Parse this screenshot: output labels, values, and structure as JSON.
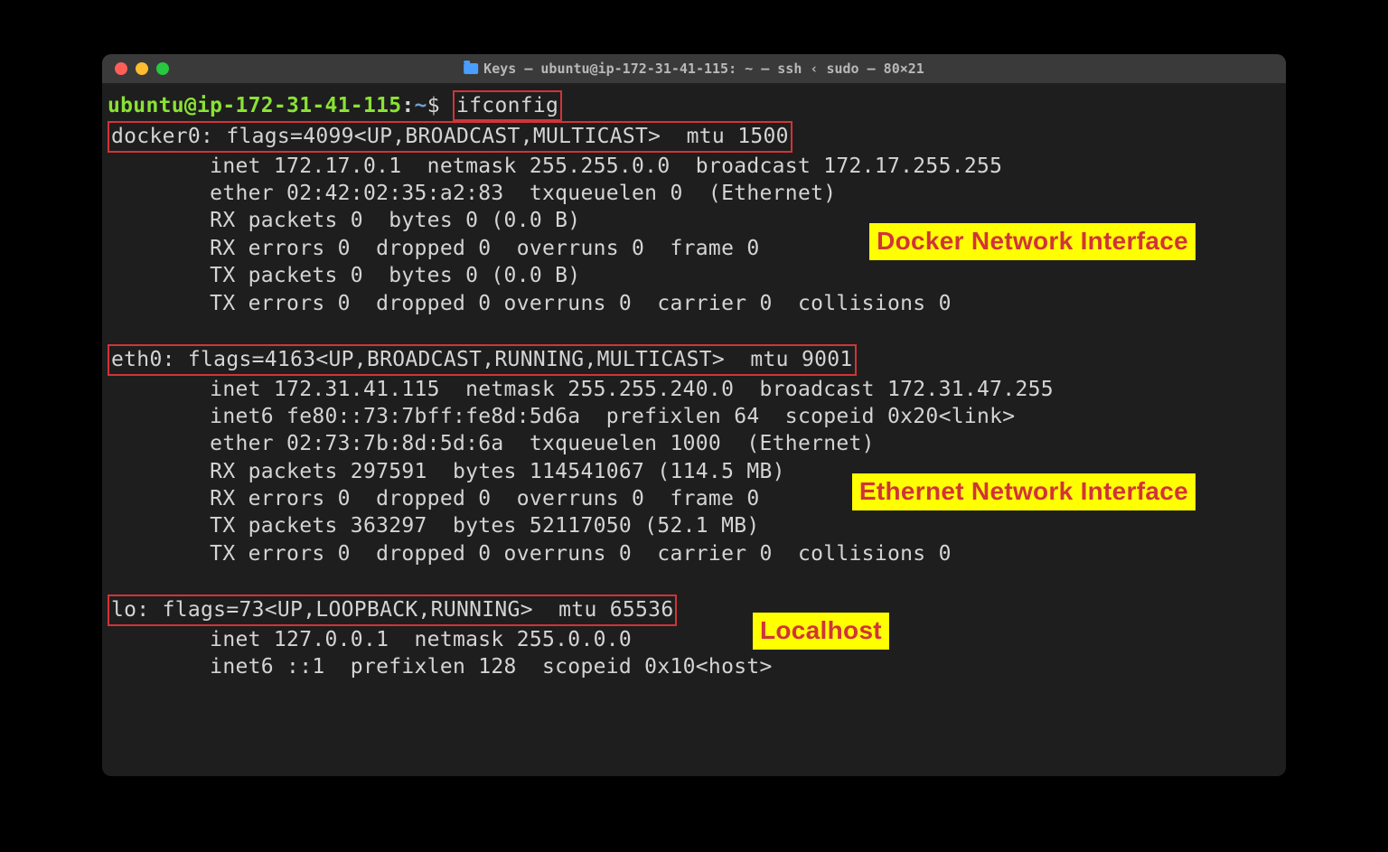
{
  "window": {
    "title": "Keys — ubuntu@ip-172-31-41-115: ~ — ssh ‹ sudo — 80×21"
  },
  "prompt": {
    "user": "ubuntu@ip-172-31-41-115",
    "path": "~",
    "command": "ifconfig"
  },
  "interfaces": {
    "docker0": {
      "header": "docker0: flags=4099<UP,BROADCAST,MULTICAST>  mtu 1500",
      "line1": "        inet 172.17.0.1  netmask 255.255.0.0  broadcast 172.17.255.255",
      "line2": "        ether 02:42:02:35:a2:83  txqueuelen 0  (Ethernet)",
      "line3": "        RX packets 0  bytes 0 (0.0 B)",
      "line4": "        RX errors 0  dropped 0  overruns 0  frame 0",
      "line5": "        TX packets 0  bytes 0 (0.0 B)",
      "line6": "        TX errors 0  dropped 0 overruns 0  carrier 0  collisions 0"
    },
    "eth0": {
      "header": "eth0: flags=4163<UP,BROADCAST,RUNNING,MULTICAST>  mtu 9001",
      "line1": "        inet 172.31.41.115  netmask 255.255.240.0  broadcast 172.31.47.255",
      "line2": "        inet6 fe80::73:7bff:fe8d:5d6a  prefixlen 64  scopeid 0x20<link>",
      "line3": "        ether 02:73:7b:8d:5d:6a  txqueuelen 1000  (Ethernet)",
      "line4": "        RX packets 297591  bytes 114541067 (114.5 MB)",
      "line5": "        RX errors 0  dropped 0  overruns 0  frame 0",
      "line6": "        TX packets 363297  bytes 52117050 (52.1 MB)",
      "line7": "        TX errors 0  dropped 0 overruns 0  carrier 0  collisions 0"
    },
    "lo": {
      "header": "lo: flags=73<UP,LOOPBACK,RUNNING>  mtu 65536",
      "line1": "        inet 127.0.0.1  netmask 255.0.0.0",
      "line2": "        inet6 ::1  prefixlen 128  scopeid 0x10<host>"
    }
  },
  "annotations": {
    "docker": "Docker Network Interface",
    "ethernet": "Ethernet Network Interface",
    "localhost": "Localhost"
  }
}
